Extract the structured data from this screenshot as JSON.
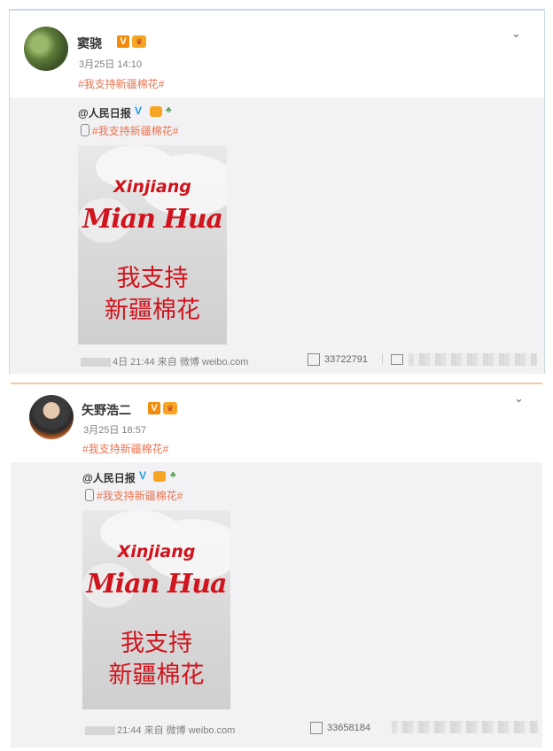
{
  "posts": [
    {
      "user": {
        "name": "窦骁",
        "v_badge": "V"
      },
      "meta": "3月25日 14:10",
      "hashtag": "#我支持新疆棉花#",
      "repost": {
        "user": "@人民日报",
        "v_badge": "V",
        "hashtag": "#我支持新疆棉花#",
        "image_text": {
          "line1": "Xinjiang",
          "line2": "Mian Hua",
          "line3": "我支持",
          "line4": "新疆棉花"
        },
        "footer": "4日 21:44 来自 微博 weibo.com",
        "share_count": "33722791"
      }
    },
    {
      "user": {
        "name": "矢野浩二",
        "v_badge": "V"
      },
      "meta": "3月25日 18:57",
      "hashtag": "#我支持新疆棉花#",
      "repost": {
        "user": "@人民日报",
        "v_badge": "V",
        "hashtag": "#我支持新疆棉花#",
        "image_text": {
          "line1": "Xinjiang",
          "line2": "Mian Hua",
          "line3": "我支持",
          "line4": "新疆棉花"
        },
        "footer": "21:44 来自 微博 weibo.com",
        "share_count": "33658184"
      }
    }
  ],
  "icons": {
    "chevron": "chevron-down-icon",
    "share": "share-icon",
    "comment": "comment-icon",
    "crown": "crown-icon",
    "tree": "tree-icon",
    "mic": "mic-icon"
  },
  "colors": {
    "accent": "#eb7350",
    "verified_orange": "#f28c0a",
    "verified_blue": "#1b9ae6",
    "image_red": "#d0131c"
  }
}
